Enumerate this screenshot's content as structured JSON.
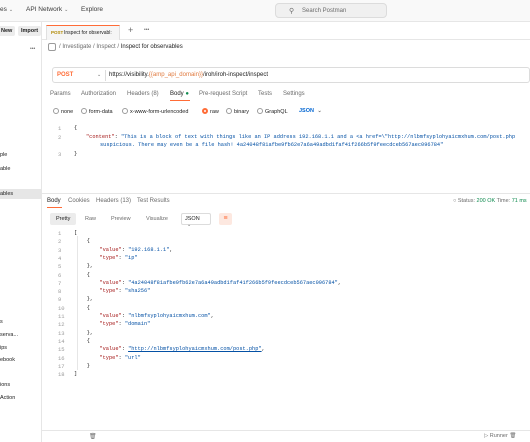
{
  "top_bar": {
    "nav_partial": "es",
    "api_network": "API Network",
    "explore": "Explore",
    "search_placeholder": "Search Postman"
  },
  "sidebar": {
    "new_label": "New",
    "import_label": "Import",
    "items": [
      "ple",
      "able",
      "ables",
      "s",
      "serva...",
      "ips",
      "ebook",
      "ions",
      "Action"
    ]
  },
  "tab": {
    "method": "POST",
    "name": "Inspect for observabl:",
    "plus": "+",
    "more": "•••"
  },
  "breadcrumb": {
    "prefix": "/ Investigate / Inspect / ",
    "current": "Inspect for observables"
  },
  "request": {
    "method": "POST",
    "url_prefix": "https://visibility.",
    "url_var": "{{amp_api_domain}}",
    "url_suffix": "/iroh/iroh-inspect/inspect"
  },
  "request_tabs": [
    "Params",
    "Authorization",
    "Headers (8)",
    "Body",
    "Pre-request Script",
    "Tests",
    "Settings"
  ],
  "body_types": [
    "none",
    "form-data",
    "x-www-form-urlencoded",
    "raw",
    "binary",
    "GraphQL"
  ],
  "body_format": "JSON",
  "request_body": {
    "line_numbers": [
      "1",
      "2",
      "",
      "3"
    ],
    "open": "{",
    "key": "\"content\"",
    "colon": ": ",
    "value_line1": "\"This is a block of text with things like an IP address 192.168.1.1 and a <a href=\\\"http://nlbmfsyplohyaicmxhum.com/post.php",
    "value_line2": "suspicious. There may even be a file hash! 4a24048f81afbe9fb62e7a6a49adbd1faf41f266b5f9feecdceb567aec096784\"",
    "close": "}"
  },
  "response_tabs": [
    "Body",
    "Cookies",
    "Headers (13)",
    "Test Results"
  ],
  "status": {
    "label": "Status:",
    "code": "200 OK",
    "time_label": "Time:",
    "time": "71 ms"
  },
  "format_buttons": [
    "Pretty",
    "Raw",
    "Preview",
    "Visualize"
  ],
  "response_format": "JSON",
  "response_body": [
    {
      "n": "1",
      "t": "["
    },
    {
      "n": "2",
      "t": "    {"
    },
    {
      "n": "3",
      "t": "        \"value\": \"192.168.1.1\","
    },
    {
      "n": "4",
      "t": "        \"type\": \"ip\""
    },
    {
      "n": "5",
      "t": "    },"
    },
    {
      "n": "6",
      "t": "    {"
    },
    {
      "n": "7",
      "t": "        \"value\": \"4a24048f81afbe9fb62e7a6a49adbd1faf41f266b5f9feecdceb567aec096784\","
    },
    {
      "n": "8",
      "t": "        \"type\": \"sha256\""
    },
    {
      "n": "9",
      "t": "    },"
    },
    {
      "n": "10",
      "t": "    {"
    },
    {
      "n": "11",
      "t": "        \"value\": \"nlbmfsyplohyaicmxhum.com\","
    },
    {
      "n": "12",
      "t": "        \"type\": \"domain\""
    },
    {
      "n": "13",
      "t": "    },"
    },
    {
      "n": "14",
      "t": "    {"
    },
    {
      "n": "15",
      "t": "        \"value\": \"http://nlbmfsyplohyaicmxhum.com/post.php\","
    },
    {
      "n": "16",
      "t": "        \"type\": \"url\""
    },
    {
      "n": "17",
      "t": "    }"
    },
    {
      "n": "18",
      "t": "]"
    }
  ],
  "bottom_bar": {
    "runner": "Runner",
    "accent": "#ff6c37"
  }
}
